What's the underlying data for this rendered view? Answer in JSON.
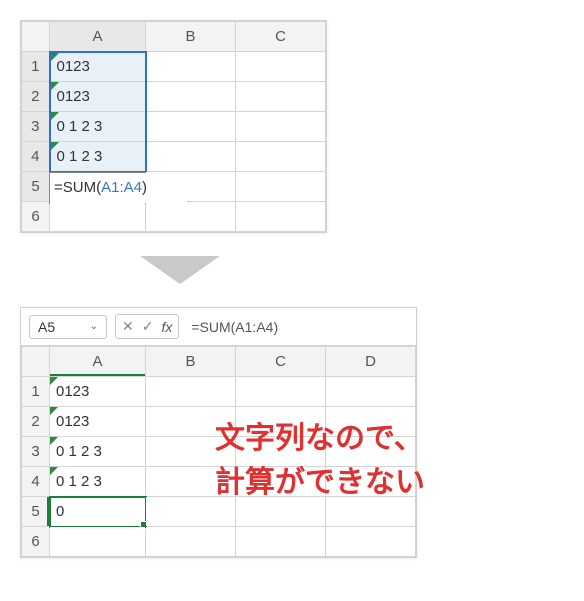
{
  "top": {
    "columns": [
      "A",
      "B",
      "C"
    ],
    "rows": [
      "1",
      "2",
      "3",
      "4",
      "5",
      "6"
    ],
    "cells": {
      "A1": "0123",
      "A2": "0123",
      "A3": "0 1 2 3",
      "A4": "0 1 2 3"
    },
    "formula": {
      "prefix": "=SUM(",
      "ref": "A1:A4",
      "suffix": ")"
    }
  },
  "bottom": {
    "namebox": "A5",
    "fx_label": "fx",
    "formula_text": "=SUM(A1:A4)",
    "columns": [
      "A",
      "B",
      "C",
      "D"
    ],
    "rows": [
      "1",
      "2",
      "3",
      "4",
      "5",
      "6"
    ],
    "cells": {
      "A1": "0123",
      "A2": "0123",
      "A3": "0 1 2 3",
      "A4": "0 1 2 3",
      "A5": "0"
    }
  },
  "annotation": {
    "line1": "文字列なので、",
    "line2": "計算ができない"
  }
}
